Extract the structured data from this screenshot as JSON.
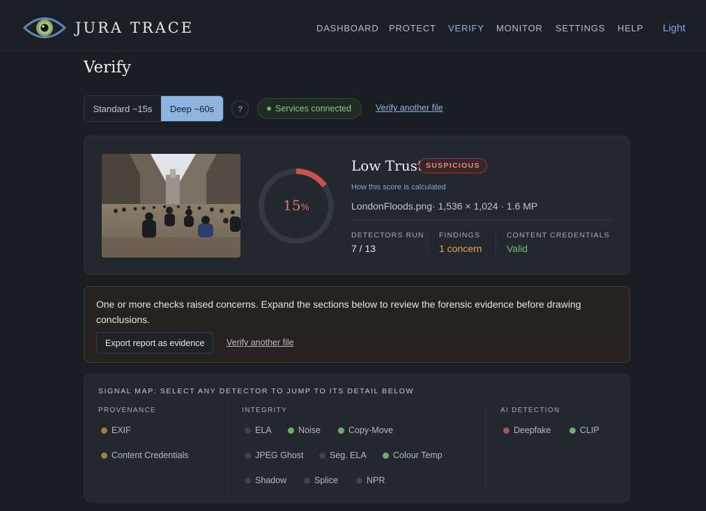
{
  "header": {
    "brand": "JURA TRACE",
    "nav": [
      {
        "label": "DASHBOARD",
        "active": false
      },
      {
        "label": "PROTECT",
        "active": false
      },
      {
        "label": "VERIFY",
        "active": true
      },
      {
        "label": "MONITOR",
        "active": false
      },
      {
        "label": "SETTINGS",
        "active": false
      },
      {
        "label": "HELP",
        "active": false
      }
    ],
    "theme_toggle": "Light"
  },
  "page": {
    "title": "Verify",
    "mode": {
      "standard": "Standard ~15s",
      "deep": "Deep ~60s",
      "selected": "deep"
    },
    "help": "?",
    "services_status": "Services connected",
    "verify_another": "Verify another file"
  },
  "result": {
    "score": "15",
    "score_unit": "%",
    "score_fraction": 0.15,
    "trust_label": "Low Trust",
    "badge": "SUSPICIOUS",
    "score_link": "How this score is calculated",
    "file_info": "LondonFloods.png· 1,536 × 1,024 · 1.6 MP",
    "stats": [
      {
        "label": "DETECTORS RUN",
        "value": "7 / 13",
        "color": "#e6e6e6"
      },
      {
        "label": "FINDINGS",
        "value": "1 concern",
        "color": "#e9a94a"
      },
      {
        "label": "CONTENT CREDENTIALS",
        "value": "Valid",
        "color": "#79b67f"
      }
    ]
  },
  "warning": {
    "text": "One or more checks raised concerns. Expand the sections below to review the forensic evidence before drawing conclusions.",
    "export_button": "Export report as evidence",
    "verify_another": "Verify another file"
  },
  "signal_map": {
    "title": "SIGNAL MAP: SELECT ANY DETECTOR TO JUMP TO ITS DETAIL BELOW",
    "groups": [
      {
        "label": "PROVENANCE",
        "items": [
          {
            "name": "EXIF",
            "status": "warn"
          },
          {
            "name": "Content Credentials",
            "status": "warn"
          }
        ]
      },
      {
        "label": "INTEGRITY",
        "items": [
          {
            "name": "ELA",
            "status": "off"
          },
          {
            "name": "Noise",
            "status": "ok"
          },
          {
            "name": "Copy-Move",
            "status": "ok"
          },
          {
            "name": "JPEG Ghost",
            "status": "off"
          },
          {
            "name": "Seg. ELA",
            "status": "off"
          },
          {
            "name": "Colour Temp",
            "status": "ok"
          },
          {
            "name": "Shadow",
            "status": "off"
          },
          {
            "name": "Splice",
            "status": "off"
          },
          {
            "name": "NPR",
            "status": "off"
          }
        ]
      },
      {
        "label": "AI DETECTION",
        "items": [
          {
            "name": "Deepfake",
            "status": "bad"
          },
          {
            "name": "CLIP",
            "status": "ok"
          }
        ]
      }
    ],
    "status_colors": {
      "ok": "#6fae6a",
      "warn": "#a57b4a",
      "bad": "#a05a5e",
      "off": "#3e4249"
    }
  }
}
